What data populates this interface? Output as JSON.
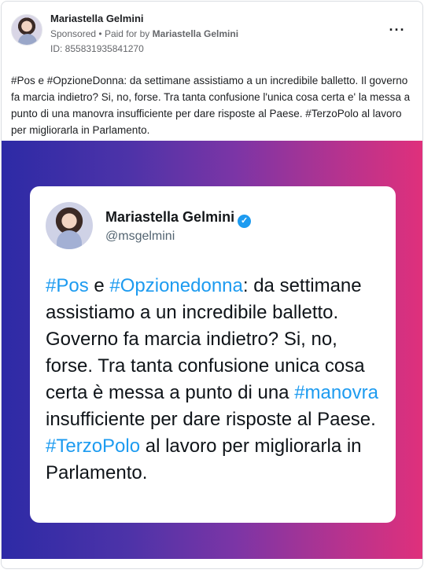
{
  "ad": {
    "author": "Mariastella Gelmini",
    "sponsored_label": "Sponsored",
    "separator": "•",
    "paid_for_prefix": "Paid for by",
    "paid_for_name": "Mariastella Gelmini",
    "id_line": "ID: 855831935841270",
    "more_icon": "more-dots-icon",
    "text": "#Pos e #OpzioneDonna: da settimane assistiamo a un incredibile balletto. Il governo fa marcia indietro? Si, no, forse. Tra tanta confusione l'unica cosa certa e' la messa a punto di una manovra insufficiente per dare risposte al Paese. #TerzoPolo al lavoro per migliorarla in Parlamento."
  },
  "creative": {
    "gradient_colors": [
      "#2d2aa6",
      "#e0307b"
    ],
    "tweet": {
      "name": "Mariastella Gelmini",
      "handle": "@msgelmini",
      "verified_icon": "verified-badge-icon",
      "hashtag_color": "#1d9bf0",
      "segments": [
        {
          "t": "#Pos",
          "hl": true
        },
        {
          "t": " e ",
          "hl": false
        },
        {
          "t": "#Opzionedonna",
          "hl": true
        },
        {
          "t": ": da settimane assistiamo a un incredibile balletto. Governo fa marcia indietro? Si, no, forse. Tra tanta confusione unica cosa certa è messa a punto di una ",
          "hl": false
        },
        {
          "t": "#manovra",
          "hl": true
        },
        {
          "t": " insufficiente per dare risposte al Paese. ",
          "hl": false
        },
        {
          "t": "#TerzoPolo",
          "hl": true
        },
        {
          "t": " al lavoro per migliorarla in Parlamento.",
          "hl": false
        }
      ]
    }
  }
}
